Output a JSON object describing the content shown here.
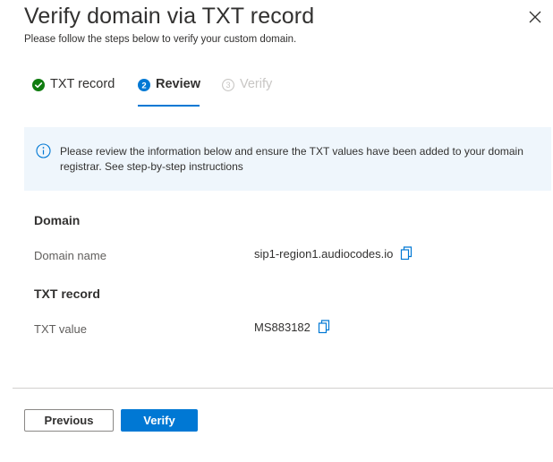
{
  "header": {
    "title": "Verify domain via TXT record",
    "subtitle": "Please follow the steps below to verify your custom domain.",
    "close_icon": "close-icon"
  },
  "steps": [
    {
      "label": "TXT record",
      "state": "completed",
      "icon": "check-circle-icon",
      "number": ""
    },
    {
      "label": "Review",
      "state": "current",
      "icon": "numbered-circle-icon",
      "number": "2"
    },
    {
      "label": "Verify",
      "state": "disabled",
      "icon": "numbered-circle-icon",
      "number": "3"
    }
  ],
  "info_banner": {
    "icon": "info-icon",
    "text": "Please review the information below and ensure the TXT values have been added to your domain registrar. See step-by-step instructions"
  },
  "domain_section": {
    "title": "Domain",
    "field_label": "Domain name",
    "field_value": "sip1-region1.audiocodes.io"
  },
  "txt_section": {
    "title": "TXT record",
    "field_label": "TXT value",
    "field_value": "MS883182"
  },
  "footer": {
    "previous_label": "Previous",
    "verify_label": "Verify"
  },
  "colors": {
    "accent": "#0078d4",
    "success": "#107c10",
    "disabled": "#c8c6c4",
    "info_background": "#eff6fc"
  }
}
